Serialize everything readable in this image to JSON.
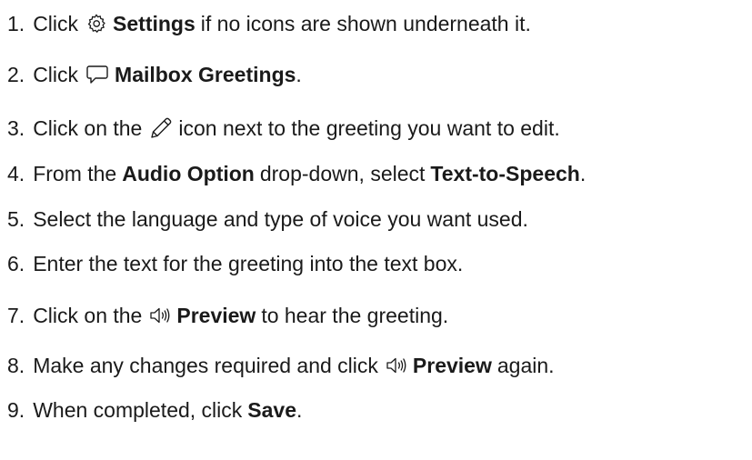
{
  "steps": [
    {
      "num": "1.",
      "before": "Click",
      "icon": "gear-icon",
      "bold": "Settings",
      "after": "if no icons are shown underneath it."
    },
    {
      "num": "2.",
      "before": "Click",
      "icon": "speech-bubble-icon",
      "bold": "Mailbox Greetings",
      "after": "."
    },
    {
      "num": "3.",
      "before": "Click on the",
      "icon": "pencil-icon",
      "after": "icon next to the greeting you want to edit."
    },
    {
      "num": "4.",
      "before": "From the",
      "bold": "Audio Option",
      "middle": "drop-down, select",
      "bold2": "Text-to-Speech",
      "after": "."
    },
    {
      "num": "5.",
      "text": "Select the language and type of voice you want used."
    },
    {
      "num": "6.",
      "text": "Enter the text for the greeting into the text box."
    },
    {
      "num": "7.",
      "before": "Click on the",
      "icon": "speaker-icon",
      "bold": "Preview",
      "after": "to hear the greeting."
    },
    {
      "num": "8.",
      "before": "Make any changes required and click",
      "icon": "speaker-icon",
      "bold": "Preview",
      "after": "again."
    },
    {
      "num": "9.",
      "before": "When completed, click",
      "bold": "Save",
      "after": "."
    }
  ]
}
